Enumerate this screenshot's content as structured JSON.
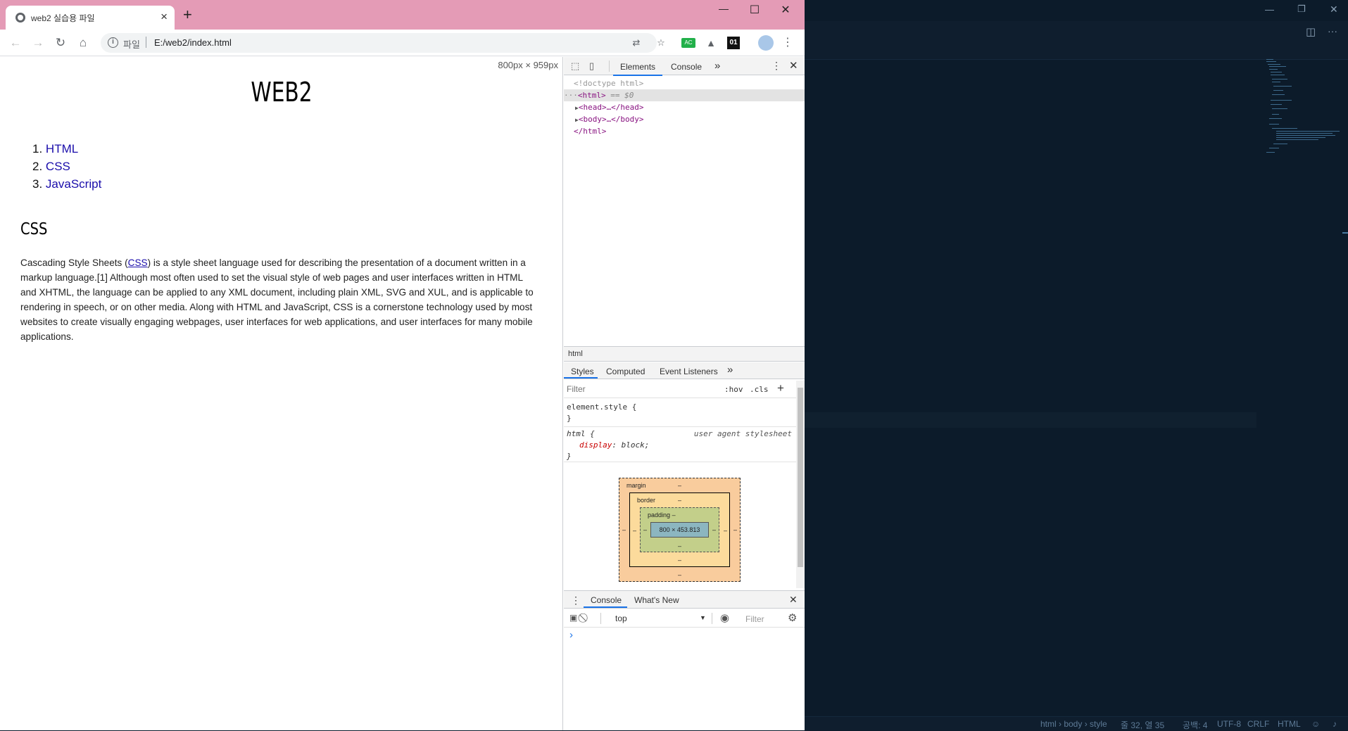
{
  "browser": {
    "tab_title": "web2 실습용 파일",
    "tab_close": "×",
    "new_tab": "+",
    "minimize": "—",
    "maximize": "☐",
    "close": "✕",
    "scheme_label": "파일",
    "url": "E:/web2/index.html",
    "ext_badge": "01"
  },
  "page": {
    "viewport_size": "800px × 959px",
    "heading": "WEB2",
    "nav": [
      {
        "num": "1.",
        "label": "HTML"
      },
      {
        "num": "2.",
        "label": "CSS"
      },
      {
        "num": "3.",
        "label": "JavaScript"
      }
    ],
    "section_heading": "CSS",
    "para_before": "Cascading Style Sheets (",
    "para_link": "CSS",
    "para_after": ") is a style sheet language used for describing the presentation of a document written in a markup language.[1] Although most often used to set the visual style of web pages and user interfaces written in HTML and XHTML, the language can be applied to any XML document, including plain XML, SVG and XUL, and is applicable to rendering in speech, or on other media. Along with HTML and JavaScript, CSS is a cornerstone technology used by most websites to create visually engaging webpages, user interfaces for web applications, and user interfaces for many mobile applications."
  },
  "devtools": {
    "tabs": [
      "Elements",
      "Console"
    ],
    "more": "»",
    "dom": {
      "doctype": "<!doctype html>",
      "html_open": "<html>",
      "selected_marker": "== $0",
      "head": "<head>…</head>",
      "body": "<body>…</body>",
      "html_close": "</html>"
    },
    "breadcrumb": "html",
    "sub_tabs": [
      "Styles",
      "Computed",
      "Event Listeners"
    ],
    "filter_placeholder": "Filter",
    "hov": ":hov",
    "cls": ".cls",
    "plus": "+",
    "element_style": "element.style {",
    "close_brace": "}",
    "html_rule_selector": "html {",
    "ua_stylesheet": "user agent stylesheet",
    "prop_name": "display",
    "prop_value": "block;",
    "box": {
      "margin": "margin",
      "border": "border",
      "padding": "padding",
      "content": "800 × 453.813",
      "dash": "–"
    },
    "drawer_tabs": [
      "Console",
      "What's New"
    ],
    "context": "top",
    "console_filter": "Filter",
    "prompt": "›"
  },
  "editor": {
    "status": {
      "path": "html › body › style",
      "position": "줄 32, 열 35",
      "spaces": "공백: 4",
      "encoding": "UTF-8",
      "eol": "CRLF",
      "language": "HTML"
    },
    "more": "···"
  }
}
